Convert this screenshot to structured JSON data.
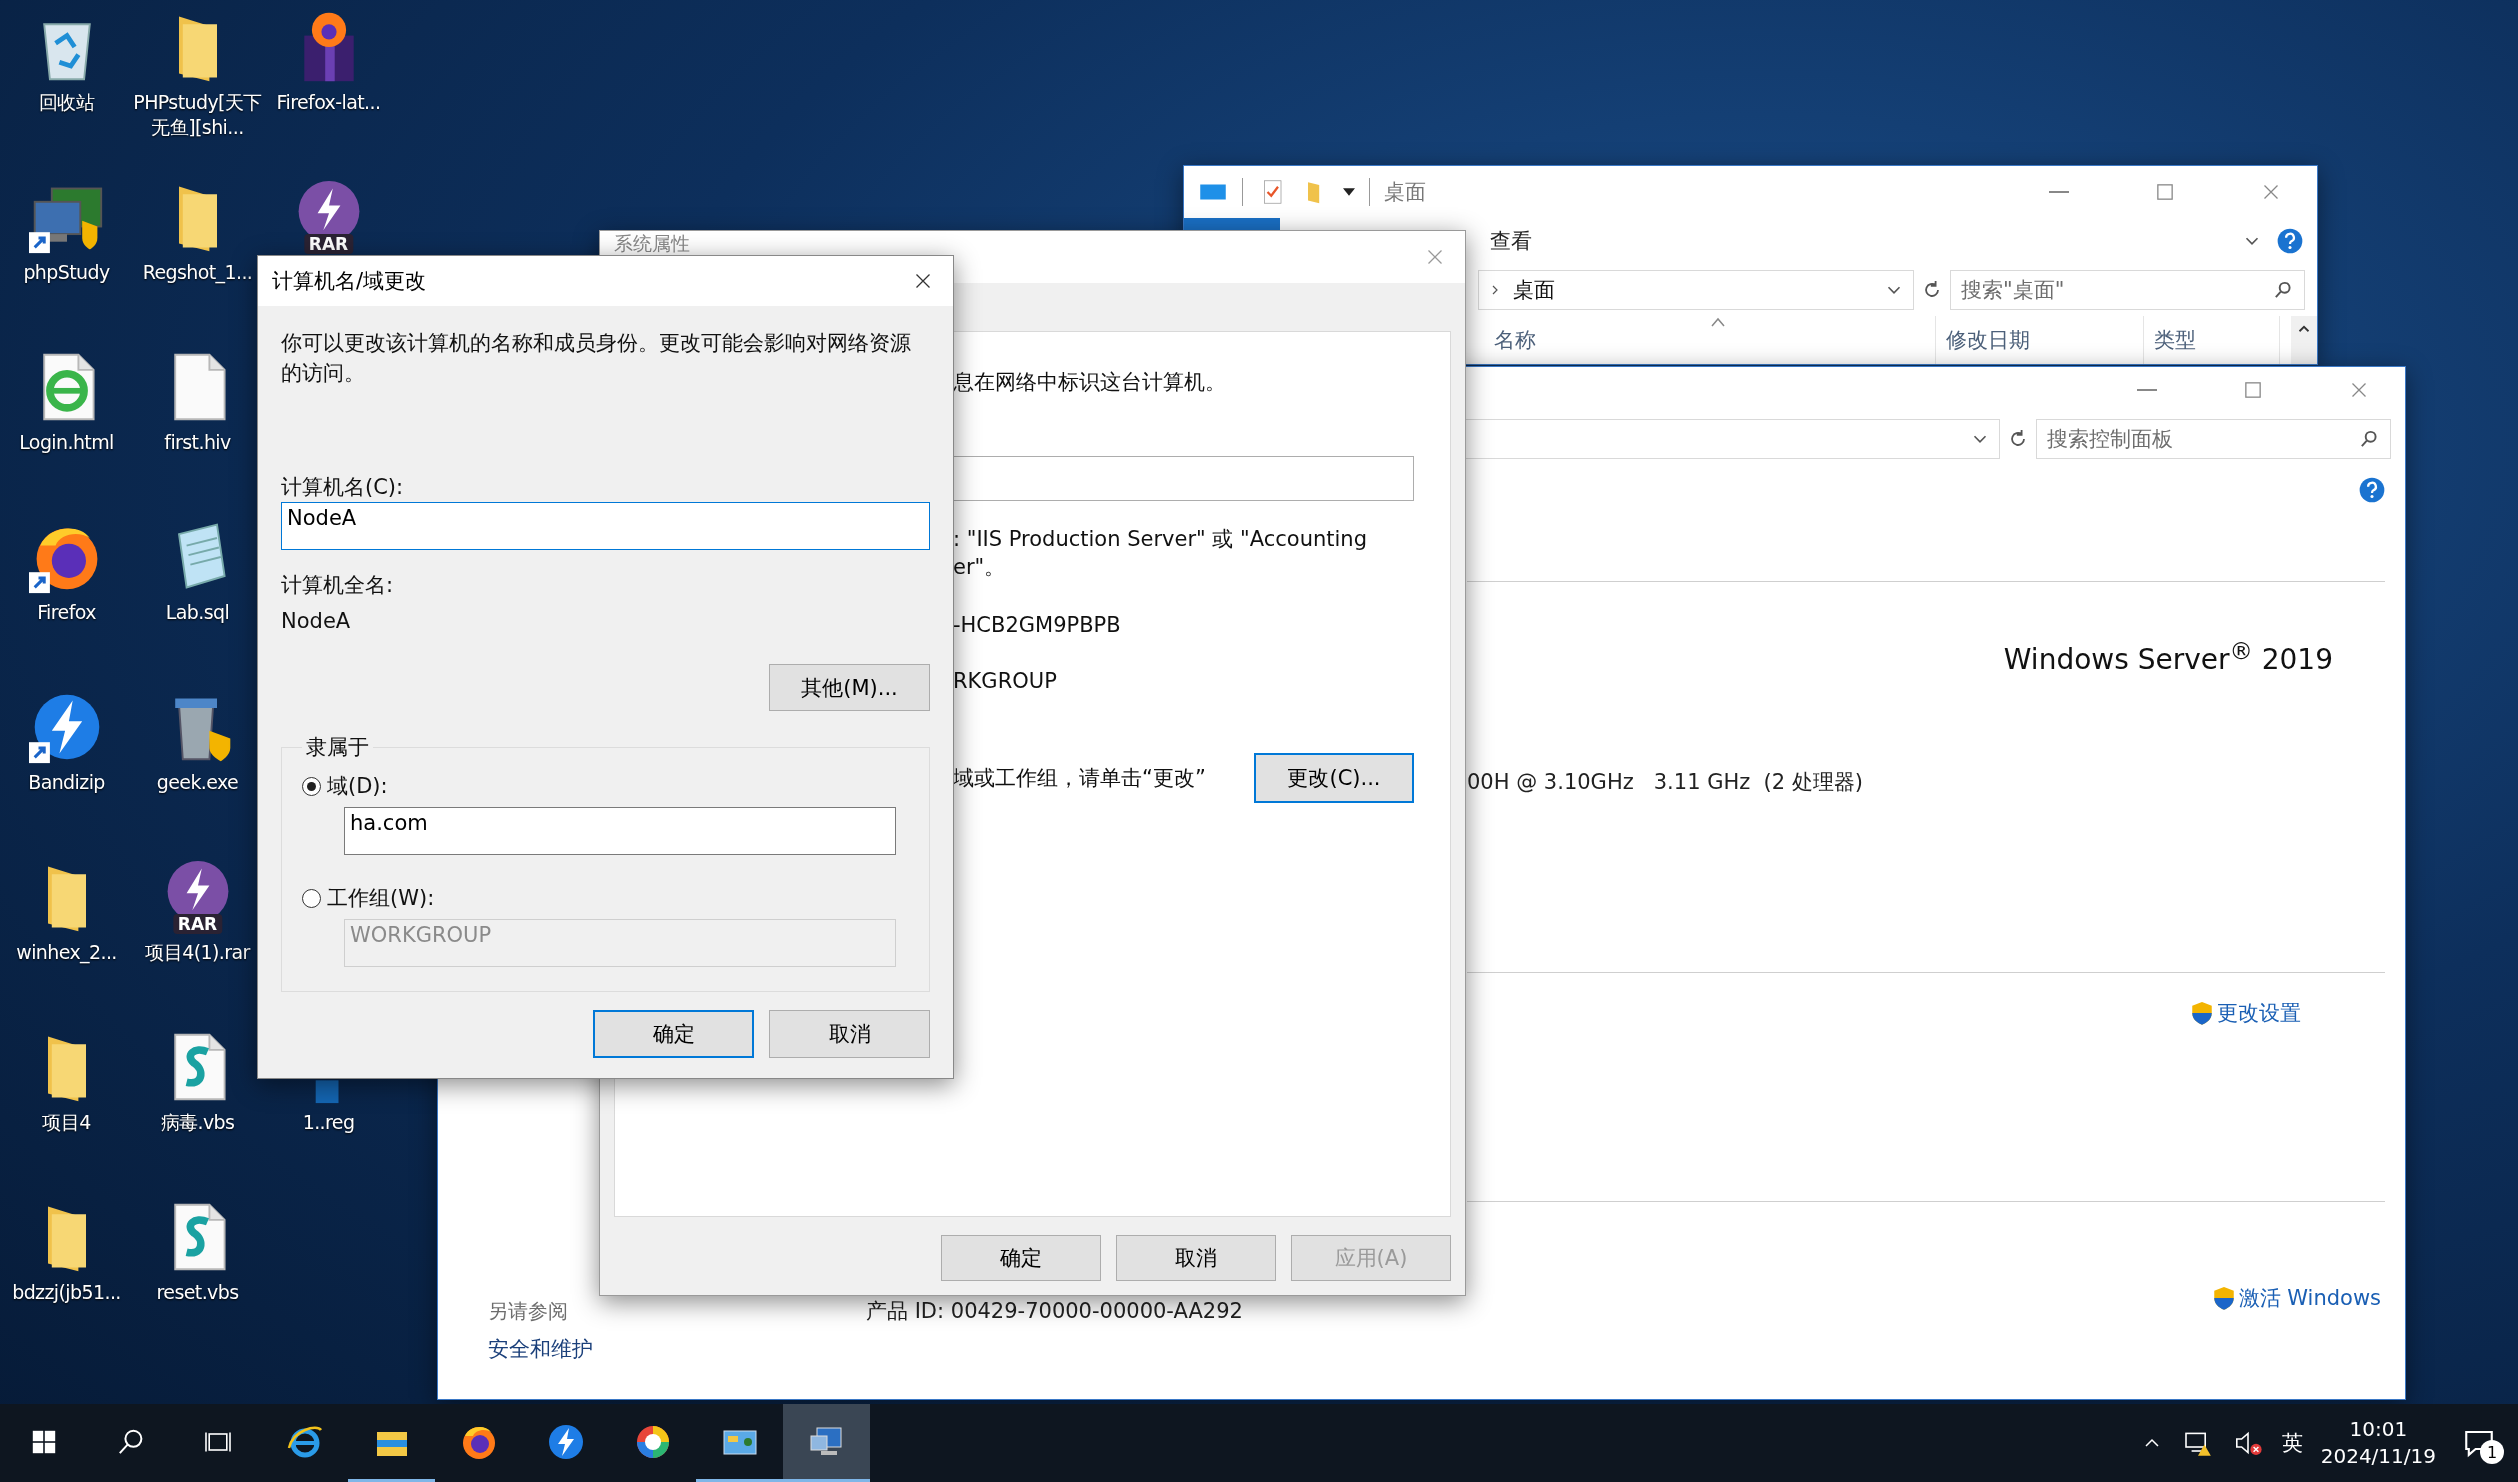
{
  "desktop_icons": [
    [
      {
        "kind": "recycle",
        "label": "回收站"
      },
      {
        "kind": "monitor",
        "label": "phpStudy",
        "shortcut": true
      },
      {
        "kind": "html",
        "label": "Login.html"
      },
      {
        "kind": "firefox",
        "label": "Firefox",
        "shortcut": true
      },
      {
        "kind": "bandizip",
        "label": "Bandizip",
        "shortcut": true
      },
      {
        "kind": "folder",
        "label": "winhex_2..."
      },
      {
        "kind": "folder",
        "label": "项目4"
      },
      {
        "kind": "folder",
        "label": "bdzzj(jb51..."
      }
    ],
    [
      {
        "kind": "folder",
        "label": "PHPstudy[天下无鱼][shi..."
      },
      {
        "kind": "folder",
        "label": "Regshot_1..."
      },
      {
        "kind": "file",
        "label": "first.hiv"
      },
      {
        "kind": "notepad",
        "label": "Lab.sql"
      },
      {
        "kind": "geek",
        "label": "geek.exe"
      },
      {
        "kind": "rar",
        "badge": "RAR",
        "label": "项目4(1).rar"
      },
      {
        "kind": "vbs",
        "label": "病毒.vbs"
      },
      {
        "kind": "vbs",
        "label": "reset.vbs"
      }
    ],
    [
      {
        "kind": "gift",
        "label": "Firefox-lat..."
      },
      {
        "kind": "rar",
        "badge": "RAR"
      },
      {
        "kind": "reg",
        "label": "1..reg"
      }
    ]
  ],
  "explorer": {
    "title": "桌面",
    "ribbon_tabs": [
      {
        "label": "查看",
        "selected": false
      }
    ],
    "address": "桌面",
    "search": {
      "placeholder": "搜索\"桌面\""
    },
    "columns": [
      {
        "label": "名称",
        "sorted": true
      },
      {
        "label": "修改日期",
        "sorted": false
      },
      {
        "label": "类型",
        "sorted": false
      }
    ]
  },
  "control_panel": {
    "search": {
      "placeholder": "搜索控制面板"
    },
    "edition": "Windows Server$^{®}$ 2019",
    "processor": "00H @ 3.10GHz   3.11 GHz  (2 处理器)",
    "change_settings": "更改设置",
    "activate": "激活 Windows",
    "product_id": "产品 ID: 00429-70000-00000-AA292",
    "see_also": {
      "title": "另请参阅",
      "links": [
        "安全和维护"
      ]
    }
  },
  "system_properties": {
    "title": "系统属性",
    "intro": "息在网络中标识这台计算机。",
    "example_lines": [
      ": \"IIS Production Server\" 或 \"Accounting",
      "er\"。"
    ],
    "full_name": "-HCB2GM9PBPB",
    "workgroup": "RKGROUP",
    "change_hint": "域或工作组，请单击“更改”",
    "change_button": "更改(C)...",
    "buttons": [
      {
        "label": "确定",
        "disabled": false
      },
      {
        "label": "取消",
        "disabled": false
      },
      {
        "label": "应用(A)",
        "disabled": true
      }
    ]
  },
  "dialog": {
    "title": "计算机名/域更改",
    "description": "你可以更改该计算机的名称和成员身份。更改可能会影响对网络资源的访问。",
    "computer_name_label": "计算机名(C):",
    "computer_name": "NodeA",
    "full_name_label": "计算机全名:",
    "full_name": "NodeA",
    "more_button": "其他(M)...",
    "member_of": "隶属于",
    "options": [
      {
        "label": "域(D):",
        "selected": true,
        "value": "ha.com"
      },
      {
        "label": "工作组(W):",
        "selected": false,
        "value": "WORKGROUP"
      }
    ],
    "buttons": [
      {
        "label": "确定",
        "default": true
      },
      {
        "label": "取消",
        "default": false
      }
    ]
  },
  "taskbar": {
    "apps": [
      {
        "kind": "start",
        "running": false,
        "active": false
      },
      {
        "kind": "search",
        "running": false,
        "active": false
      },
      {
        "kind": "taskview",
        "running": false,
        "active": false
      },
      {
        "kind": "ie",
        "running": false,
        "active": false
      },
      {
        "kind": "explorer",
        "running": true,
        "active": false
      },
      {
        "kind": "firefox",
        "running": false,
        "active": false
      },
      {
        "kind": "bandizip",
        "running": false,
        "active": false
      },
      {
        "kind": "colorwheel",
        "running": false,
        "active": false
      },
      {
        "kind": "controlpanel",
        "running": true,
        "active": false
      },
      {
        "kind": "system",
        "running": true,
        "active": true
      }
    ],
    "ime": "英",
    "time": "10:01",
    "date": "2024/11/19",
    "notifications": "1"
  }
}
